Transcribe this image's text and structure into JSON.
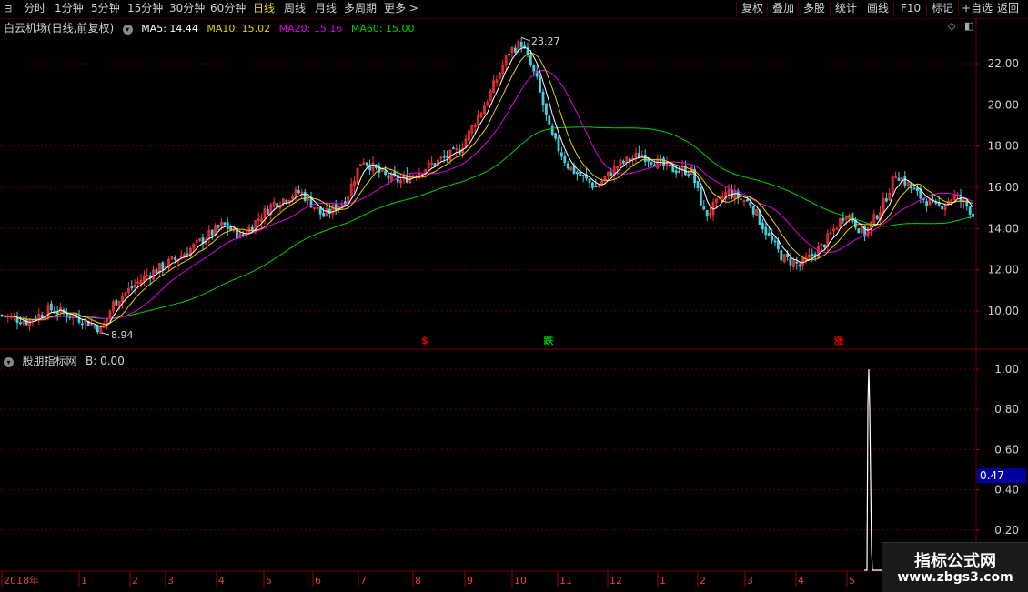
{
  "toolbar": {
    "left": [
      "分时",
      "1分钟",
      "5分钟",
      "15分钟",
      "30分钟",
      "60分钟",
      "日线",
      "周线",
      "月线",
      "多周期",
      "更多 >"
    ],
    "active": "日线",
    "right": [
      "复权",
      "叠加",
      "多股",
      "统计",
      "画线",
      "F10",
      "标记",
      "+自选",
      "返回"
    ]
  },
  "main_chart": {
    "title": "白云机场(日线,前复权)",
    "ma": [
      {
        "label": "MA5: 14.44",
        "color": "#ffffff"
      },
      {
        "label": "MA10: 15.02",
        "color": "#e8d000"
      },
      {
        "label": "MA20: 15.16",
        "color": "#e000e0"
      },
      {
        "label": "MA60: 15.00",
        "color": "#00d000"
      }
    ],
    "high_label": "23.27",
    "low_label": "8.94",
    "y_ticks": [
      "22.00",
      "20.00",
      "18.00",
      "16.00",
      "14.00",
      "12.00",
      "10.00"
    ],
    "markers": [
      {
        "text": "$",
        "color": "#e00000"
      },
      {
        "text": "跌",
        "color": "#00c000"
      },
      {
        "text": "涨",
        "color": "#e00000"
      }
    ]
  },
  "sub_chart": {
    "title": "股朋指标网",
    "value_label": "B: 0.00",
    "y_ticks": [
      "1.00",
      "0.80",
      "0.60",
      "0.40",
      "0.20"
    ],
    "current_value": "0.47"
  },
  "x_axis": {
    "labels": [
      "2018年",
      "1",
      "2",
      "3",
      "4",
      "5",
      "6",
      "7",
      "8",
      "9",
      "10",
      "11",
      "12",
      "1",
      "2",
      "3",
      "4",
      "5"
    ]
  },
  "watermark": {
    "line1": "指标公式网",
    "line2": "www.zbgs3.com"
  },
  "colors": {
    "up": "#ff3030",
    "down": "#40d0e0",
    "grid": "#5a0000"
  }
}
